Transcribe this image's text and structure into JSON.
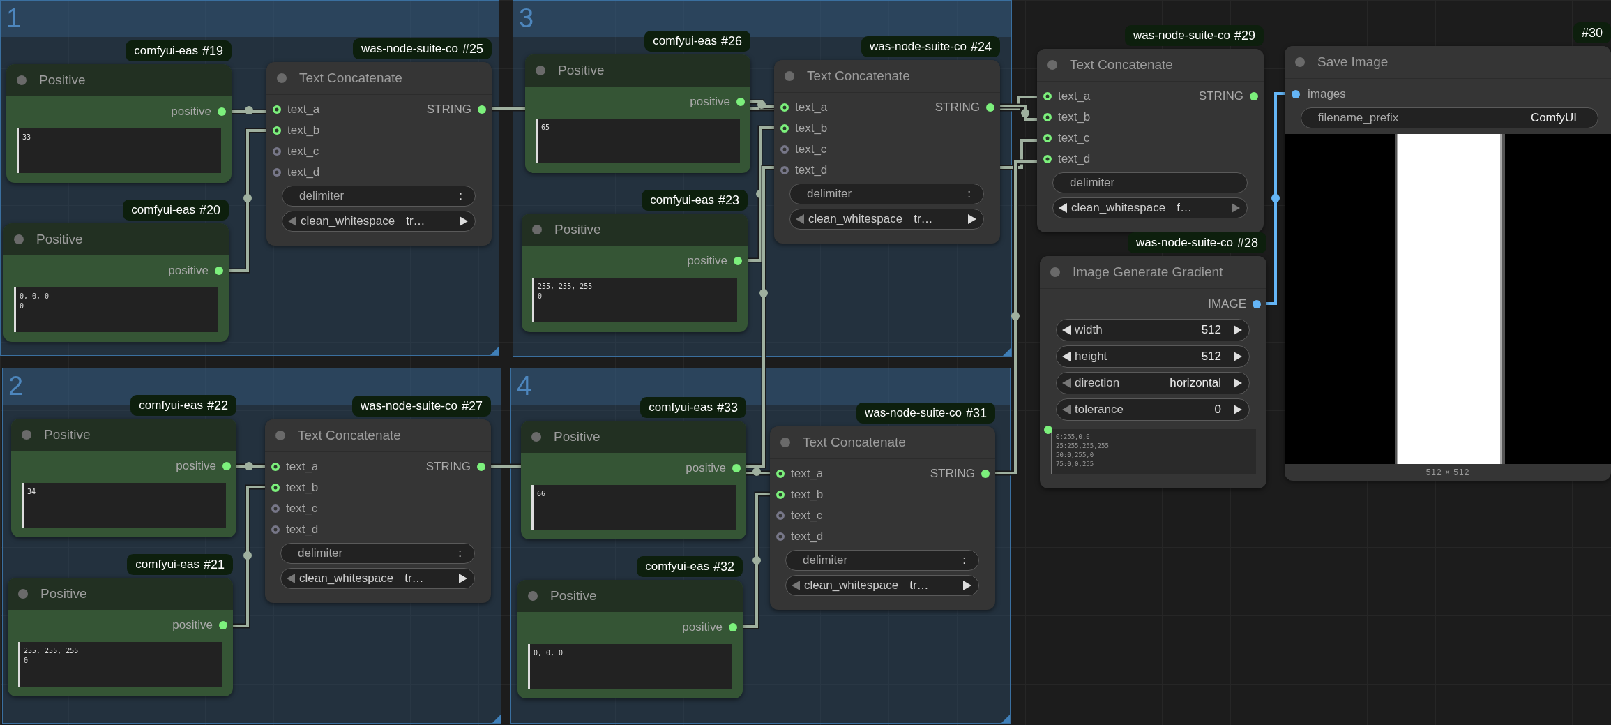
{
  "groups": [
    {
      "title": "1"
    },
    {
      "title": "3"
    },
    {
      "title": "2"
    },
    {
      "title": "4"
    }
  ],
  "nodes": [
    {
      "kind": "prompt",
      "source": "comfyui-eas",
      "id": "#19",
      "title": "Positive",
      "output": "positive",
      "text": "33"
    },
    {
      "kind": "prompt",
      "source": "comfyui-eas",
      "id": "#20",
      "title": "Positive",
      "output": "positive",
      "text": "0, 0, 0\n0"
    },
    {
      "kind": "concat",
      "source": "was-node-suite-co",
      "id": "#25",
      "title": "Text Concatenate",
      "inputs": [
        {
          "label": "text_a",
          "connected": true
        },
        {
          "label": "text_b",
          "connected": true
        },
        {
          "label": "text_c",
          "connected": false
        },
        {
          "label": "text_d",
          "connected": false
        }
      ],
      "output": "STRING",
      "delimiter": {
        "label": "delimiter",
        "value": ":"
      },
      "toggle": {
        "label": "clean_whitespace",
        "value": "tr…",
        "prev_enabled": false,
        "next_enabled": true
      }
    },
    {
      "kind": "prompt",
      "source": "comfyui-eas",
      "id": "#26",
      "title": "Positive",
      "output": "positive",
      "text": "65"
    },
    {
      "kind": "prompt",
      "source": "comfyui-eas",
      "id": "#23",
      "title": "Positive",
      "output": "positive",
      "text": "255, 255, 255\n0"
    },
    {
      "kind": "concat",
      "source": "was-node-suite-co",
      "id": "#24",
      "title": "Text Concatenate",
      "inputs": [
        {
          "label": "text_a",
          "connected": true
        },
        {
          "label": "text_b",
          "connected": true
        },
        {
          "label": "text_c",
          "connected": false
        },
        {
          "label": "text_d",
          "connected": false
        }
      ],
      "output": "STRING",
      "delimiter": {
        "label": "delimiter",
        "value": ":"
      },
      "toggle": {
        "label": "clean_whitespace",
        "value": "tr…",
        "prev_enabled": false,
        "next_enabled": true
      }
    },
    {
      "kind": "concat",
      "source": "was-node-suite-co",
      "id": "#29",
      "title": "Text Concatenate",
      "inputs": [
        {
          "label": "text_a",
          "connected": true
        },
        {
          "label": "text_b",
          "connected": true
        },
        {
          "label": "text_c",
          "connected": true
        },
        {
          "label": "text_d",
          "connected": true
        }
      ],
      "output": "STRING",
      "delimiter": {
        "label": "delimiter"
      },
      "toggle": {
        "label": "clean_whitespace",
        "value": "f…",
        "prev_enabled": true,
        "next_enabled": false
      }
    },
    {
      "kind": "gradient",
      "source": "was-node-suite-co",
      "id": "#28",
      "title": "Image Generate Gradient",
      "output": "IMAGE",
      "widgets": [
        {
          "label": "width",
          "value": "512",
          "prev_enabled": true,
          "next_enabled": true
        },
        {
          "label": "height",
          "value": "512",
          "prev_enabled": true,
          "next_enabled": true
        },
        {
          "label": "direction",
          "value": "horizontal",
          "prev_enabled": false,
          "next_enabled": true
        },
        {
          "label": "tolerance",
          "value": "0",
          "prev_enabled": false,
          "next_enabled": true
        }
      ],
      "text": "0:255,0,0\n25:255,255,255\n50:0,255,0\n75:0,0,255"
    },
    {
      "kind": "save",
      "id": "#30",
      "title": "Save Image",
      "input": "images",
      "prefix": {
        "label": "filename_prefix",
        "value": "ComfyUI"
      },
      "caption": "512 × 512"
    },
    {
      "kind": "prompt",
      "source": "comfyui-eas",
      "id": "#22",
      "title": "Positive",
      "output": "positive",
      "text": "34"
    },
    {
      "kind": "prompt",
      "source": "comfyui-eas",
      "id": "#21",
      "title": "Positive",
      "output": "positive",
      "text": "255, 255, 255\n0"
    },
    {
      "kind": "concat",
      "source": "was-node-suite-co",
      "id": "#27",
      "title": "Text Concatenate",
      "inputs": [
        {
          "label": "text_a",
          "connected": true
        },
        {
          "label": "text_b",
          "connected": true
        },
        {
          "label": "text_c",
          "connected": false
        },
        {
          "label": "text_d",
          "connected": false
        }
      ],
      "output": "STRING",
      "delimiter": {
        "label": "delimiter",
        "value": ":"
      },
      "toggle": {
        "label": "clean_whitespace",
        "value": "tr…",
        "prev_enabled": false,
        "next_enabled": true
      }
    },
    {
      "kind": "prompt",
      "source": "comfyui-eas",
      "id": "#33",
      "title": "Positive",
      "output": "positive",
      "text": "66"
    },
    {
      "kind": "prompt",
      "source": "comfyui-eas",
      "id": "#32",
      "title": "Positive",
      "output": "positive",
      "text": "0, 0, 0"
    },
    {
      "kind": "concat",
      "source": "was-node-suite-co",
      "id": "#31",
      "title": "Text Concatenate",
      "inputs": [
        {
          "label": "text_a",
          "connected": true
        },
        {
          "label": "text_b",
          "connected": true
        },
        {
          "label": "text_c",
          "connected": false
        },
        {
          "label": "text_d",
          "connected": false
        }
      ],
      "output": "STRING",
      "delimiter": {
        "label": "delimiter",
        "value": ":"
      },
      "toggle": {
        "label": "clean_whitespace",
        "value": "tr…",
        "prev_enabled": false,
        "next_enabled": true
      }
    }
  ]
}
